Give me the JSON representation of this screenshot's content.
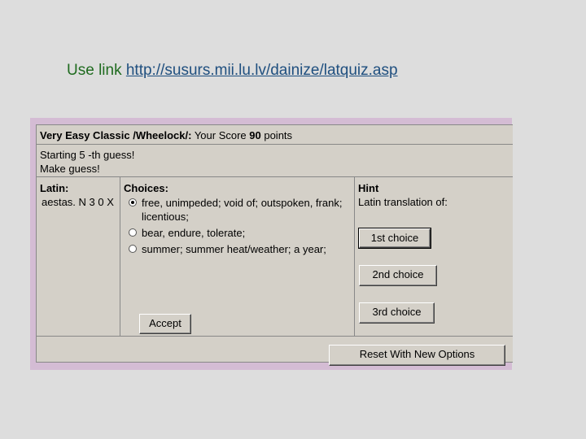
{
  "heading": {
    "prefix": "Use link ",
    "link": "http://susurs.mii.lu.lv/dainize/latquiz.asp"
  },
  "quiz": {
    "title_bold": "Very Easy Classic /Wheelock/:",
    "score_prefix": " Your Score ",
    "score_value": "90",
    "score_suffix": " points",
    "status_line1": "Starting 5 -th guess!",
    "status_line2": "Make guess!",
    "latin_label": "Latin:",
    "latin_word": "aestas. N 3 0 X",
    "choices_label": "Choices:",
    "choices": [
      {
        "text": "free, unimpeded; void of; outspoken, frank; licentious;",
        "selected": true
      },
      {
        "text": "bear, endure, tolerate;",
        "selected": false
      },
      {
        "text": "summer; summer heat/weather; a year;",
        "selected": false
      }
    ],
    "accept_label": "Accept",
    "hint_label": "Hint",
    "hint_text": "Latin translation of:",
    "hint_buttons": [
      "1st choice",
      "2nd choice",
      "3rd choice"
    ],
    "reset_label": "Reset With New Options"
  }
}
